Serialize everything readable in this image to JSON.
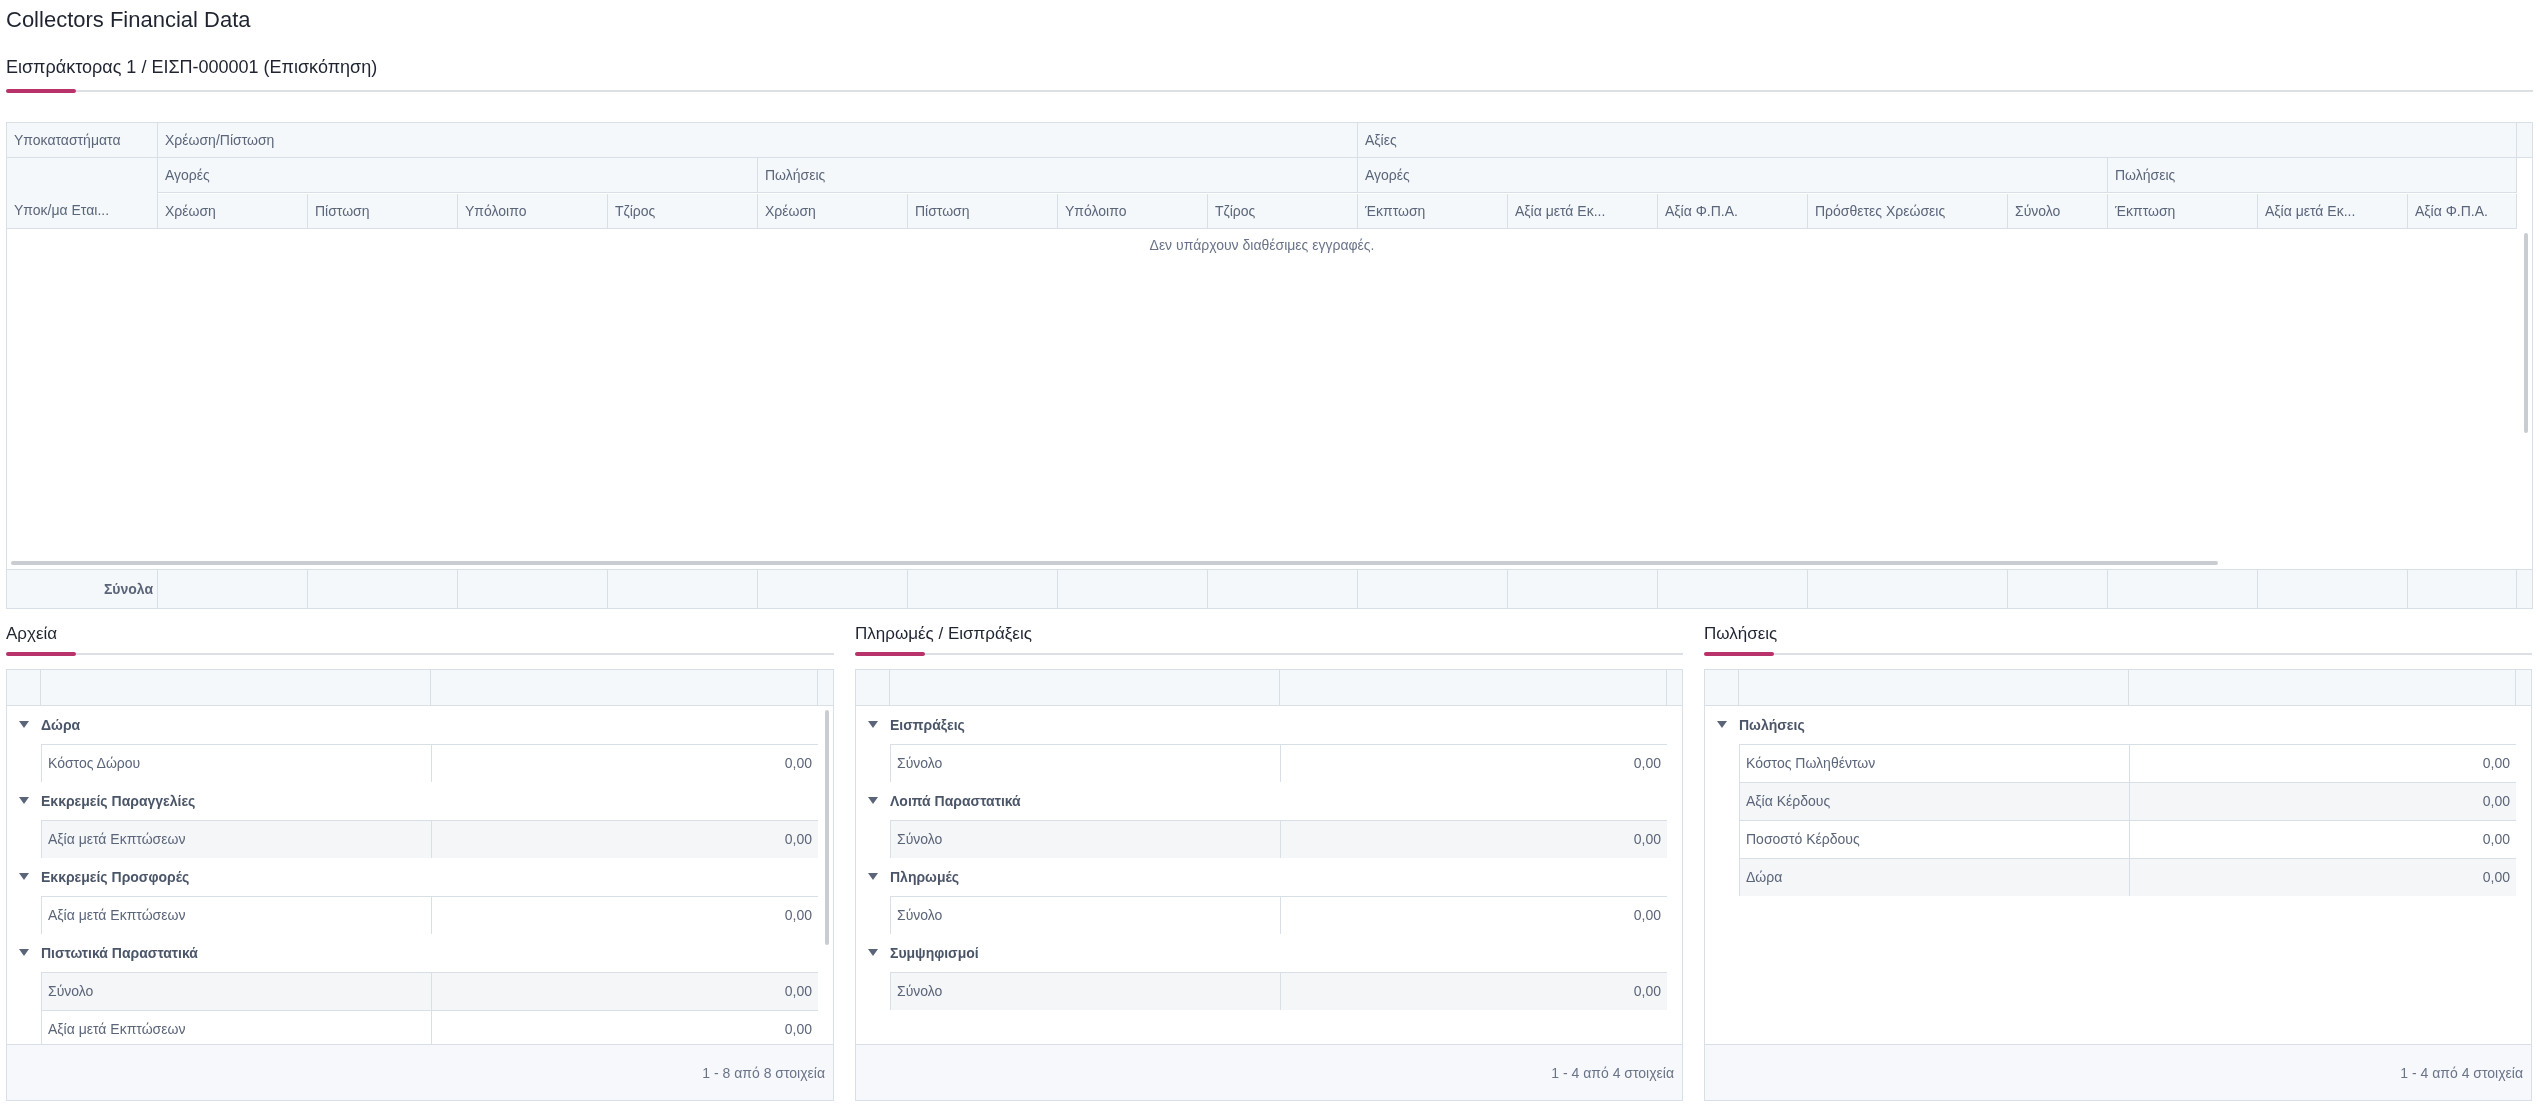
{
  "page_title": "Collectors Financial Data",
  "overview_heading": "Εισπράκτορας 1 / ΕΙΣΠ-000001 (Επισκόπηση)",
  "table": {
    "header": [
      {
        "label": "Υποκαταστήματα",
        "columns": [
          "Υποκ/μα Εται..."
        ]
      },
      {
        "label": "Χρέωση/Πίστωση",
        "groups": [
          {
            "label": "Αγορές",
            "columns": [
              "Χρέωση",
              "Πίστωση",
              "Υπόλοιπο",
              "Τζίρος"
            ]
          },
          {
            "label": "Πωλήσεις",
            "columns": [
              "Χρέωση",
              "Πίστωση",
              "Υπόλοιπο",
              "Τζίρος"
            ]
          }
        ]
      },
      {
        "label": "Αξίες",
        "groups": [
          {
            "label": "Αγορές",
            "columns": [
              "Έκπτωση",
              "Αξία μετά Εκ...",
              "Αξία Φ.Π.Α.",
              "Πρόσθετες Χρεώσεις",
              "Σύνολο"
            ]
          },
          {
            "label": "Πωλήσεις",
            "columns": [
              "Έκπτωση",
              "Αξία μετά Εκ...",
              "Αξία Φ.Π.Α."
            ]
          }
        ]
      }
    ],
    "empty_message": "Δεν υπάρχουν διαθέσιμες εγγραφές.",
    "totals_label": "Σύνολα"
  },
  "panels": [
    {
      "title": "Αρχεία",
      "groups": [
        {
          "label": "Δώρα",
          "expanded": true,
          "rows": [
            {
              "label": "Κόστος Δώρου",
              "value": "0,00"
            }
          ]
        },
        {
          "label": "Εκκρεμείς Παραγγελίες",
          "expanded": true,
          "rows": [
            {
              "label": "Αξία μετά Εκπτώσεων",
              "value": "0,00"
            }
          ]
        },
        {
          "label": "Εκκρεμείς Προσφορές",
          "expanded": true,
          "rows": [
            {
              "label": "Αξία μετά Εκπτώσεων",
              "value": "0,00"
            }
          ]
        },
        {
          "label": "Πιστωτικά Παραστατικά",
          "expanded": true,
          "rows": [
            {
              "label": "Σύνολο",
              "value": "0,00"
            },
            {
              "label": "Αξία μετά Εκπτώσεων",
              "value": "0,00"
            }
          ]
        }
      ],
      "pager": "1 - 8 από 8 στοιχεία"
    },
    {
      "title": "Πληρωμές / Εισπράξεις",
      "groups": [
        {
          "label": "Εισπράξεις",
          "expanded": true,
          "rows": [
            {
              "label": "Σύνολο",
              "value": "0,00"
            }
          ]
        },
        {
          "label": "Λοιπά Παραστατικά",
          "expanded": true,
          "rows": [
            {
              "label": "Σύνολο",
              "value": "0,00"
            }
          ]
        },
        {
          "label": "Πληρωμές",
          "expanded": true,
          "rows": [
            {
              "label": "Σύνολο",
              "value": "0,00"
            }
          ]
        },
        {
          "label": "Συμψηφισμοί",
          "expanded": true,
          "rows": [
            {
              "label": "Σύνολο",
              "value": "0,00"
            }
          ]
        }
      ],
      "pager": "1 - 4 από 4 στοιχεία"
    },
    {
      "title": "Πωλήσεις",
      "groups": [
        {
          "label": "Πωλήσεις",
          "expanded": true,
          "rows": [
            {
              "label": "Κόστος Πωληθέντων",
              "value": "0,00"
            },
            {
              "label": "Αξία Κέρδους",
              "value": "0,00"
            },
            {
              "label": "Ποσοστό Κέρδους",
              "value": "0,00"
            },
            {
              "label": "Δώρα",
              "value": "0,00"
            }
          ]
        }
      ],
      "pager": "1 - 4 από 4 στοιχεία"
    }
  ]
}
